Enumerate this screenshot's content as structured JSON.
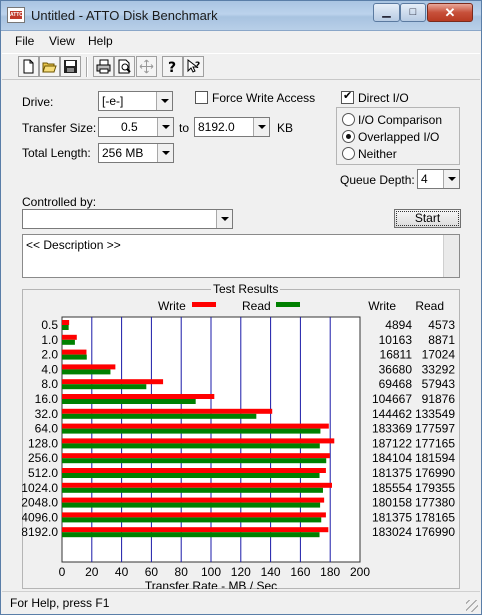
{
  "window": {
    "title": "Untitled - ATTO Disk Benchmark",
    "icon_text": "ATTO"
  },
  "caption_buttons": {
    "minimize": "▁",
    "maximize": "□",
    "close": "✕"
  },
  "menu": [
    "File",
    "View",
    "Help"
  ],
  "toolbar": [
    "new-icon",
    "open-icon",
    "save-icon",
    "print-icon",
    "print-preview-icon",
    "move-icon",
    "help-icon",
    "context-help-icon"
  ],
  "form": {
    "drive_label": "Drive:",
    "drive_value": "[-e-]",
    "transfer_size_label": "Transfer Size:",
    "transfer_from": "0.5",
    "to_label": "to",
    "transfer_to": "8192.0",
    "kb_label": "KB",
    "total_length_label": "Total Length:",
    "total_length_value": "256 MB",
    "force_write_label": "Force Write Access",
    "force_write_checked": false,
    "direct_io_label": "Direct I/O",
    "direct_io_checked": true,
    "io_comparison_label": "I/O Comparison",
    "overlapped_io_label": "Overlapped I/O",
    "neither_label": "Neither",
    "selected_mode": "Overlapped I/O",
    "queue_depth_label": "Queue Depth:",
    "queue_depth_value": "4",
    "controlled_by_label": "Controlled by:",
    "controlled_by_value": "",
    "start_label": "Start",
    "description": "<< Description >>"
  },
  "results": {
    "title": "Test Results",
    "write_legend": "Write",
    "read_legend": "Read",
    "write_header": "Write",
    "read_header": "Read",
    "xlabel": "Transfer Rate - MB / Sec"
  },
  "chart_data": {
    "type": "bar",
    "orientation": "horizontal",
    "title": "Test Results",
    "xlabel": "Transfer Rate - MB / Sec",
    "xlim": [
      0,
      200
    ],
    "xticks": [
      0,
      20,
      40,
      60,
      80,
      100,
      120,
      140,
      160,
      180,
      200
    ],
    "categories": [
      "0.5",
      "1.0",
      "2.0",
      "4.0",
      "8.0",
      "16.0",
      "32.0",
      "64.0",
      "128.0",
      "256.0",
      "512.0",
      "1024.0",
      "2048.0",
      "4096.0",
      "8192.0"
    ],
    "series": [
      {
        "name": "Write",
        "color": "#ff0000",
        "values": [
          4894,
          10163,
          16811,
          36680,
          69468,
          104667,
          144462,
          183369,
          187122,
          184104,
          181375,
          185554,
          180158,
          181375,
          183024
        ]
      },
      {
        "name": "Read",
        "color": "#008000",
        "values": [
          4573,
          8871,
          17024,
          33292,
          57943,
          91876,
          133549,
          177597,
          177165,
          181594,
          176990,
          179355,
          177380,
          178165,
          176990
        ]
      }
    ],
    "value_units_in_table": "KB/s",
    "legend_position": "top"
  },
  "status": {
    "text": "For Help, press F1"
  }
}
